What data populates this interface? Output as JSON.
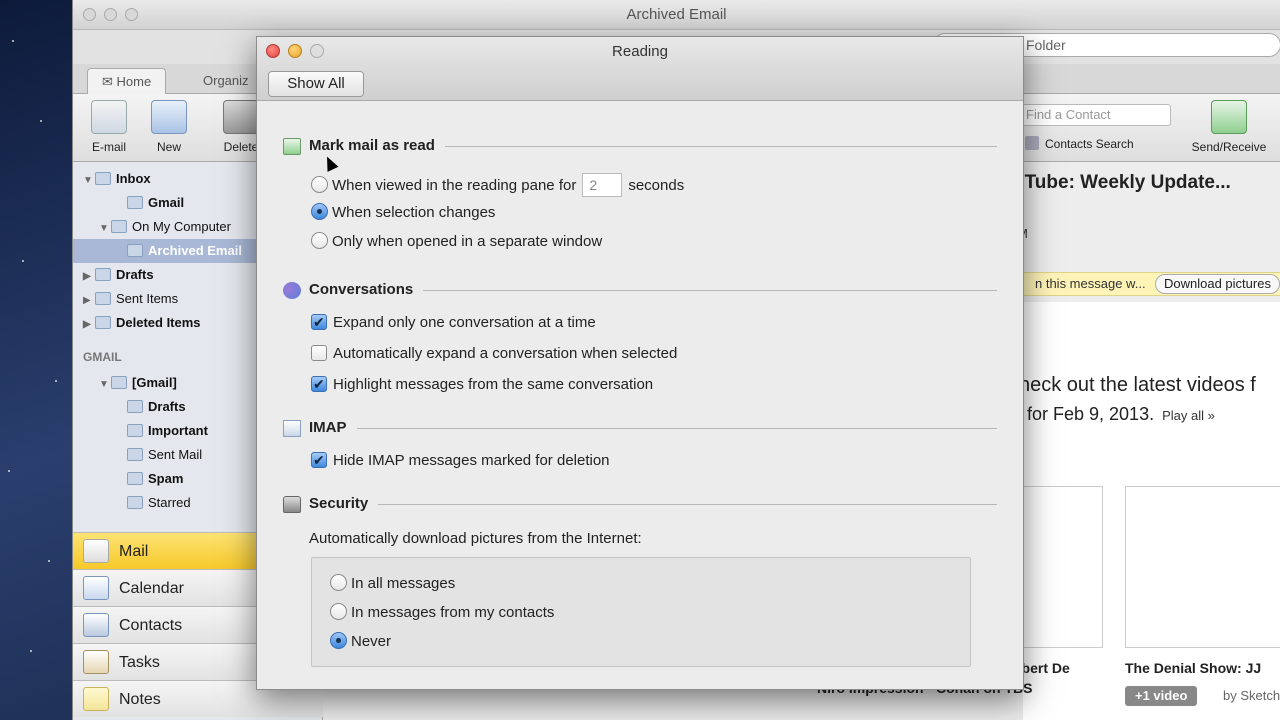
{
  "bg_window": {
    "title": "Archived Email",
    "search_placeholder": "is Folder",
    "tabs": [
      "Home",
      "Organiz"
    ],
    "ribbon": {
      "email": "E-mail",
      "new": "New",
      "delete": "Delete",
      "find_contact": "Find a Contact",
      "contacts_search": "Contacts Search",
      "send_receive": "Send/Receive"
    },
    "folders": [
      {
        "label": "Inbox",
        "level": 0,
        "bold": true,
        "tri": "▼"
      },
      {
        "label": "Gmail",
        "level": 2,
        "bold": true,
        "tri": ""
      },
      {
        "label": "On My Computer",
        "level": 1,
        "bold": false,
        "tri": "▼"
      },
      {
        "label": "Archived Email",
        "level": 2,
        "bold": true,
        "tri": "",
        "selected": true
      },
      {
        "label": "Drafts",
        "level": 0,
        "bold": true,
        "tri": "▶"
      },
      {
        "label": "Sent Items",
        "level": 0,
        "bold": false,
        "tri": "▶"
      },
      {
        "label": "Deleted Items",
        "level": 0,
        "bold": true,
        "tri": "▶"
      }
    ],
    "group_label": "GMAIL",
    "gmail_folders": [
      {
        "label": "[Gmail]",
        "level": 1,
        "bold": true,
        "tri": "▼"
      },
      {
        "label": "Drafts",
        "level": 2,
        "bold": true,
        "tri": ""
      },
      {
        "label": "Important",
        "level": 2,
        "bold": true,
        "tri": ""
      },
      {
        "label": "Sent Mail",
        "level": 2,
        "bold": false,
        "tri": ""
      },
      {
        "label": "Spam",
        "level": 2,
        "bold": true,
        "tri": ""
      },
      {
        "label": "Starred",
        "level": 2,
        "bold": false,
        "tri": ""
      }
    ],
    "nav": [
      "Mail",
      "Calendar",
      "Contacts",
      "Tasks",
      "Notes"
    ],
    "message": {
      "title": "uTube: Weekly Update...",
      "meta": "M",
      "warning": "n this message w...",
      "download_pictures": "Download pictures",
      "body_line1": "heck out the latest videos f",
      "body_line2": "for Feb 9, 2013.",
      "play_all": "Play all »",
      "video1_title": "obert De",
      "video1_sub": "Niro Impression - Conan on TBS",
      "video2_title": "The Denial Show: JJ",
      "video_badge": "+1 video",
      "video_by": "by Sketch"
    }
  },
  "dialog": {
    "title": "Reading",
    "show_all": "Show All",
    "mark_read": {
      "title": "Mark mail as read",
      "opt_viewed_prefix": "When viewed in the reading pane for",
      "seconds_value": "2",
      "opt_viewed_suffix": "seconds",
      "opt_selection": "When selection changes",
      "opt_separate": "Only when opened in a separate window",
      "selected": "selection"
    },
    "conversations": {
      "title": "Conversations",
      "opt1": "Expand only one conversation at a time",
      "opt2": "Automatically expand a conversation when selected",
      "opt3": "Highlight messages from the same conversation"
    },
    "imap": {
      "title": "IMAP",
      "opt1": "Hide IMAP messages marked for deletion"
    },
    "security": {
      "title": "Security",
      "caption": "Automatically download pictures from the Internet:",
      "opt_all": "In all messages",
      "opt_contacts": "In messages from my contacts",
      "opt_never": "Never",
      "selected": "never"
    }
  }
}
